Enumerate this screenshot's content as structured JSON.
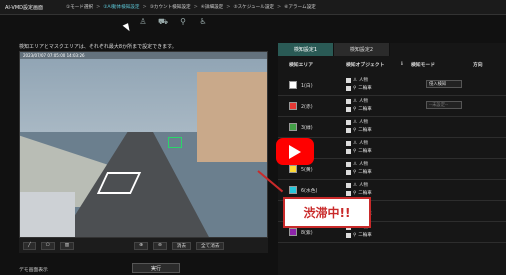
{
  "app_title": "AI-VMD設定画面",
  "steps": [
    "①モード選択",
    "②AI動体検知設定",
    "③カウント検知設定",
    "④詳細設定",
    "⑤スケジュール設定",
    "⑥アラーム設定"
  ],
  "note": "検知エリアとマスクエリアは、それぞれ最大8か所まで設定できます。",
  "timestamp": "2023/07/07 07:05:00 14:03:26",
  "video_buttons": [
    "消去",
    "全て消去"
  ],
  "demo_label": "デモ画面表示",
  "exec_label": "実行",
  "tabs": [
    "検知設定1",
    "検知設定2"
  ],
  "headers": [
    "検知エリア",
    "検知オブジェクト",
    "検知モード",
    "方向"
  ],
  "areas": [
    {
      "name": "1(白)",
      "color": "#ffffff",
      "mode": "侵入検知"
    },
    {
      "name": "2(赤)",
      "color": "#e53935",
      "mode": "--未設定--"
    },
    {
      "name": "3(緑)",
      "color": "#43a047",
      "mode": ""
    },
    {
      "name": "4(青)",
      "color": "#1e88e5",
      "mode": ""
    },
    {
      "name": "5(黄)",
      "color": "#fdd835",
      "mode": ""
    },
    {
      "name": "6(水色)",
      "color": "#26c6da",
      "mode": ""
    },
    {
      "name": "7(桃)",
      "color": "#ec407a",
      "mode": ""
    },
    {
      "name": "8(紫)",
      "color": "#8e24aa",
      "mode": ""
    }
  ],
  "obj_labels": [
    "人物",
    "二輪車"
  ],
  "annotation": "渋滞中!!"
}
